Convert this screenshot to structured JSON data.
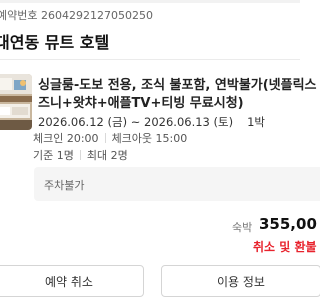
{
  "reservation": {
    "number_text": "예약번호 2604292127050250",
    "hotel_name": "대연동 뮤트 호텔"
  },
  "room": {
    "title_line1": "싱글룸-도보 전용, 조식 불포함, 연박불가(넷플릭스",
    "title_line2": "즈니+왓챠+애플TV+티빙 무료시청)",
    "check_in_date": "2026.06.12 (금)",
    "date_separator": " ~ ",
    "check_out_date": "2026.06.13 (토)",
    "nights": "1박",
    "checkin_time": "체크인 20:00",
    "checkout_time": "체크아웃 15:00",
    "occupancy_base": "기준 1명",
    "occupancy_max": "최대 2명",
    "parking": "주차불가"
  },
  "price": {
    "label": "숙박",
    "value": "355,00",
    "status": "취소 및 환불"
  },
  "buttons": {
    "cancel_label": "예약 취소",
    "info_label": "이용 정보"
  },
  "colors": {
    "accent_red": "#e8232d",
    "divider": "#ebebeb",
    "box_bg": "#f5f5f5"
  }
}
